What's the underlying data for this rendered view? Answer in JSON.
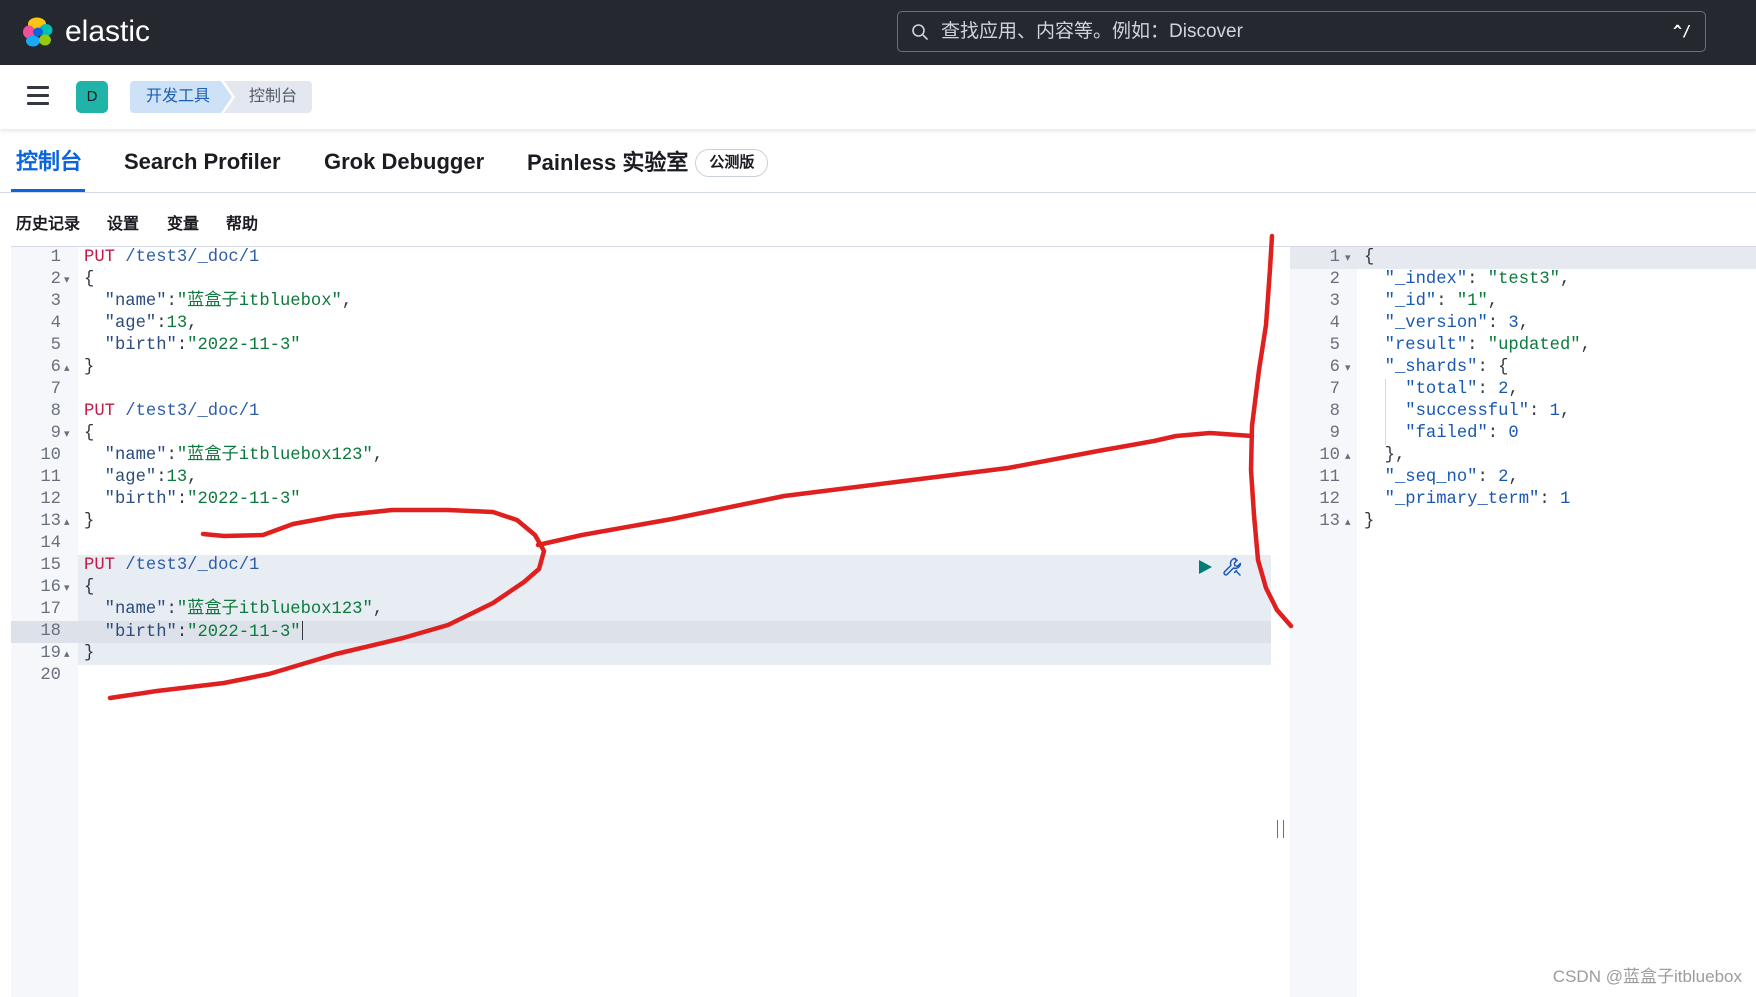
{
  "theme": {
    "header_bg": "#25282f",
    "accent": "#0b64dd",
    "annotation": "#e0201f"
  },
  "header": {
    "brand": "elastic",
    "search_placeholder": "查找应用、内容等。例如：Discover",
    "search_shortcut": "^/"
  },
  "nav": {
    "space_avatar": "D",
    "breadcrumbs": [
      "开发工具",
      "控制台"
    ]
  },
  "tabs": [
    {
      "label": "控制台",
      "active": true
    },
    {
      "label": "Search Profiler",
      "active": false
    },
    {
      "label": "Grok Debugger",
      "active": false
    },
    {
      "label": "Painless 实验室",
      "active": false,
      "badge": "公测版"
    }
  ],
  "toolbar": {
    "items": [
      "历史记录",
      "设置",
      "变量",
      "帮助"
    ]
  },
  "request_editor": {
    "selected_request_lines": [
      15,
      19
    ],
    "active_line": 18,
    "cursor_line": 18,
    "lines": [
      {
        "n": 1,
        "tokens": [
          {
            "method": "PUT"
          },
          {
            "url": " /test3/_doc/1"
          }
        ]
      },
      {
        "n": 2,
        "fold": "fold-open-icon",
        "tokens": [
          {
            "punct": "{"
          }
        ]
      },
      {
        "n": 3,
        "tokens": [
          {
            "key": "  \"name\""
          },
          {
            "punct": ":"
          },
          {
            "string": "\"蓝盒子itbluebox\""
          },
          {
            "punct": ","
          }
        ]
      },
      {
        "n": 4,
        "tokens": [
          {
            "key": "  \"age\""
          },
          {
            "punct": ":"
          },
          {
            "number": "13"
          },
          {
            "punct": ","
          }
        ]
      },
      {
        "n": 5,
        "tokens": [
          {
            "key": "  \"birth\""
          },
          {
            "punct": ":"
          },
          {
            "string": "\"2022-11-3\""
          }
        ]
      },
      {
        "n": 6,
        "fold": "fold-close-icon",
        "tokens": [
          {
            "punct": "}"
          }
        ]
      },
      {
        "n": 7,
        "tokens": []
      },
      {
        "n": 8,
        "tokens": [
          {
            "method": "PUT"
          },
          {
            "url": " /test3/_doc/1"
          }
        ]
      },
      {
        "n": 9,
        "fold": "fold-open-icon",
        "tokens": [
          {
            "punct": "{"
          }
        ]
      },
      {
        "n": 10,
        "tokens": [
          {
            "key": "  \"name\""
          },
          {
            "punct": ":"
          },
          {
            "string": "\"蓝盒子itbluebox123\""
          },
          {
            "punct": ","
          }
        ]
      },
      {
        "n": 11,
        "tokens": [
          {
            "key": "  \"age\""
          },
          {
            "punct": ":"
          },
          {
            "number": "13"
          },
          {
            "punct": ","
          }
        ]
      },
      {
        "n": 12,
        "tokens": [
          {
            "key": "  \"birth\""
          },
          {
            "punct": ":"
          },
          {
            "string": "\"2022-11-3\""
          }
        ]
      },
      {
        "n": 13,
        "fold": "fold-close-icon",
        "tokens": [
          {
            "punct": "}"
          }
        ]
      },
      {
        "n": 14,
        "tokens": []
      },
      {
        "n": 15,
        "tokens": [
          {
            "method": "PUT"
          },
          {
            "url": " /test3/_doc/1"
          }
        ]
      },
      {
        "n": 16,
        "fold": "fold-open-icon",
        "tokens": [
          {
            "punct": "{"
          }
        ]
      },
      {
        "n": 17,
        "tokens": [
          {
            "key": "  \"name\""
          },
          {
            "punct": ":"
          },
          {
            "string": "\"蓝盒子itbluebox123\""
          },
          {
            "punct": ","
          }
        ]
      },
      {
        "n": 18,
        "tokens": [
          {
            "key": "  \"birth\""
          },
          {
            "punct": ":"
          },
          {
            "string": "\"2022-11-3\""
          }
        ]
      },
      {
        "n": 19,
        "fold": "fold-close-icon",
        "tokens": [
          {
            "punct": "}"
          }
        ]
      },
      {
        "n": 20,
        "tokens": []
      }
    ]
  },
  "response_viewer": {
    "active_line": 1,
    "lines": [
      {
        "n": 1,
        "fold": "fold-open-icon",
        "tokens": [
          {
            "punct": "{"
          }
        ]
      },
      {
        "n": 2,
        "tokens": [
          {
            "key": "  \"_index\""
          },
          {
            "punct": ": "
          },
          {
            "string": "\"test3\""
          },
          {
            "punct": ","
          }
        ]
      },
      {
        "n": 3,
        "tokens": [
          {
            "key": "  \"_id\""
          },
          {
            "punct": ": "
          },
          {
            "string": "\"1\""
          },
          {
            "punct": ","
          }
        ]
      },
      {
        "n": 4,
        "tokens": [
          {
            "key": "  \"_version\""
          },
          {
            "punct": ": "
          },
          {
            "number": "3"
          },
          {
            "punct": ","
          }
        ]
      },
      {
        "n": 5,
        "tokens": [
          {
            "key": "  \"result\""
          },
          {
            "punct": ": "
          },
          {
            "string": "\"updated\""
          },
          {
            "punct": ","
          }
        ]
      },
      {
        "n": 6,
        "fold": "fold-open-icon",
        "tokens": [
          {
            "key": "  \"_shards\""
          },
          {
            "punct": ": {"
          }
        ]
      },
      {
        "n": 7,
        "tokens": [
          {
            "key": "    \"total\""
          },
          {
            "punct": ": "
          },
          {
            "number": "2"
          },
          {
            "punct": ","
          }
        ]
      },
      {
        "n": 8,
        "tokens": [
          {
            "key": "    \"successful\""
          },
          {
            "punct": ": "
          },
          {
            "number": "1"
          },
          {
            "punct": ","
          }
        ]
      },
      {
        "n": 9,
        "tokens": [
          {
            "key": "    \"failed\""
          },
          {
            "punct": ": "
          },
          {
            "number": "0"
          }
        ]
      },
      {
        "n": 10,
        "fold": "fold-close-icon",
        "tokens": [
          {
            "punct": "  },"
          }
        ]
      },
      {
        "n": 11,
        "tokens": [
          {
            "key": "  \"_seq_no\""
          },
          {
            "punct": ": "
          },
          {
            "number": "2"
          },
          {
            "punct": ","
          }
        ]
      },
      {
        "n": 12,
        "tokens": [
          {
            "key": "  \"_primary_term\""
          },
          {
            "punct": ": "
          },
          {
            "number": "1"
          }
        ]
      },
      {
        "n": 13,
        "fold": "fold-close-icon",
        "tokens": [
          {
            "punct": "}"
          }
        ]
      }
    ]
  },
  "watermark": "CSDN @蓝盒子itbluebox"
}
